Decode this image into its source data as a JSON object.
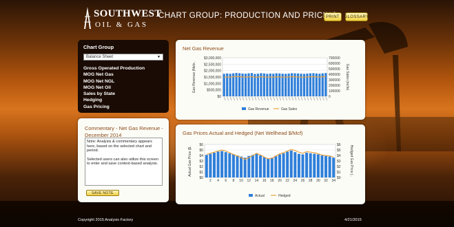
{
  "header": {
    "logo_line1": "SOUTHWEST",
    "logo_line2": "OIL & GAS",
    "title": "CHART GROUP: PRODUCTION AND PRICING",
    "print_label": "PRINT",
    "glossary_label": "GLOSSARY"
  },
  "nav": {
    "title": "Chart Group",
    "select_value": "Balance Sheet",
    "items": [
      "Gross Operated Production",
      "MOG Net Gas",
      "MOG Net NGL",
      "MOG Net Oil",
      "Sales by State",
      "Hedging",
      "Gas Pricing"
    ]
  },
  "commentary": {
    "title": "Commentary - Net Gas Revenue - December 2014",
    "line1": "Note: Analysis & commentary appears here, based on the selected chart and period.",
    "line2": "Selected users can also utilize this screen to enter and save context-based analysis.",
    "save_label": "SAVE NOTE"
  },
  "footer": {
    "copyright": "Copyright 2015 Analysis Factory",
    "date": "4/21/2015"
  },
  "colors": {
    "bar": "#2f7fd9",
    "line": "#e8a23c",
    "accent": "#8a4a1a",
    "button": "#f1cf3b"
  },
  "chart_data": [
    {
      "type": "bar",
      "title": "Net Gas Revenue",
      "ylabel": "Gas Revenue (Netx..",
      "y2label": "Gas Sales (mcfe)",
      "ylim": [
        0,
        3000000
      ],
      "y2lim": [
        0,
        700000
      ],
      "y_ticks": [
        "$3,000,000",
        "$2,500,000",
        "$2,000,000",
        "$1,500,000",
        "$1,000,000",
        "$500,000",
        "$0"
      ],
      "y2_ticks": [
        "700000",
        "600000",
        "500000",
        "400000",
        "300000",
        "200000",
        "100000",
        "0"
      ],
      "legend": "bottom",
      "series": [
        {
          "name": "Gas Revenue",
          "values": [
            1750000,
            1780000,
            1760000,
            1790000,
            1820000,
            1800000,
            1770000,
            1760000,
            1790000,
            1810000,
            1740000,
            1760000,
            1800000,
            1780000,
            1750000,
            1770000,
            1760000,
            1790000,
            1780000,
            1760000,
            1750000,
            1770000,
            1800000,
            1790000,
            1780000,
            1760000,
            1750000,
            1770000,
            1790000,
            1800000,
            1780000,
            1760000,
            1790000,
            1810000
          ]
        },
        {
          "name": "Gas Sales",
          "values": [
            350000,
            352000,
            348000,
            355000,
            360000,
            357000,
            351000,
            349000,
            354000,
            358000,
            346000,
            350000,
            356000,
            353000,
            347000,
            351000,
            349000,
            354000,
            352000,
            349000,
            347000,
            351000,
            357000,
            355000,
            353000,
            349000,
            347000,
            351000,
            355000,
            357000,
            353000,
            349000,
            355000,
            359000
          ]
        }
      ]
    },
    {
      "type": "bar",
      "title": "Gas Prices Actual and Hedged (Net Wellhead $/Mcf)",
      "ylabel": "Actual Gas Price ($..",
      "y2label": "Hedged Gas Price (..",
      "ylim": [
        0,
        6
      ],
      "y2lim": [
        0,
        6
      ],
      "y_ticks": [
        "$6",
        "$5",
        "$4",
        "$3",
        "$2",
        "$1",
        "$0"
      ],
      "y2_ticks": [
        "$6",
        "$5",
        "$4",
        "$3",
        "$2",
        "$1",
        "$0"
      ],
      "categories": [
        "2",
        "4",
        "6",
        "8",
        "10",
        "12",
        "14",
        "16",
        "18",
        "20",
        "22",
        "24",
        "26",
        "28",
        "30",
        "32",
        "34"
      ],
      "legend": "bottom",
      "series": [
        {
          "name": "Actual",
          "values": [
            4.1,
            4.3,
            4.5,
            4.7,
            4.8,
            4.6,
            4.4,
            4.2,
            4.0,
            3.8,
            3.6,
            3.9,
            4.1,
            4.3,
            4.0,
            3.7,
            3.5,
            3.6,
            3.9,
            4.2,
            4.4,
            4.7,
            4.9,
            4.6,
            4.3,
            4.2,
            4.5,
            4.4,
            4.3,
            4.2,
            4.0,
            3.9,
            3.8,
            3.6
          ]
        },
        {
          "name": "Hedged",
          "values": [
            4.2,
            4.4,
            4.6,
            4.8,
            5.0,
            4.8,
            4.5,
            4.2,
            3.9,
            3.6,
            3.3,
            3.6,
            4.0,
            4.4,
            4.1,
            3.7,
            3.4,
            3.5,
            3.9,
            4.3,
            4.5,
            4.8,
            5.1,
            4.9,
            4.6,
            4.4,
            4.7,
            4.6,
            4.5,
            4.3,
            4.1,
            4.0,
            3.9,
            3.7
          ]
        }
      ]
    }
  ]
}
